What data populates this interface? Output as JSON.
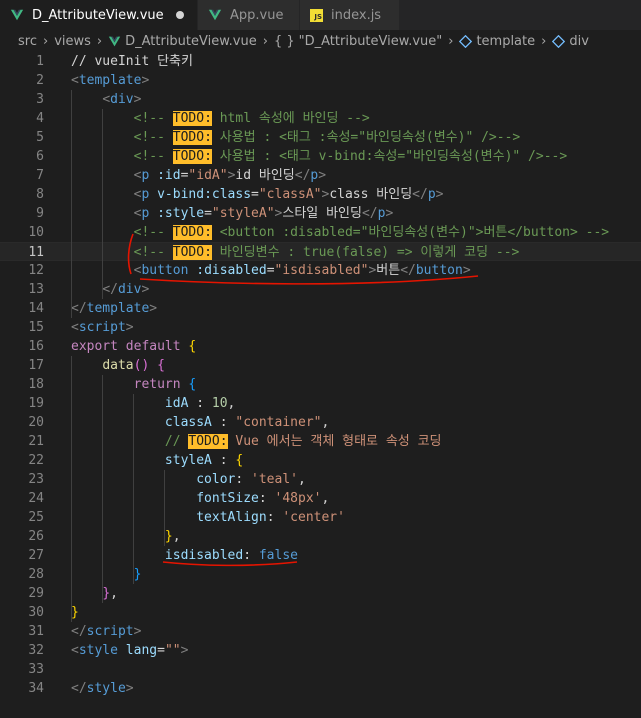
{
  "tabs": [
    {
      "label": "D_AttributeView.vue",
      "icon": "vue-icon",
      "active": true,
      "modified": true
    },
    {
      "label": "App.vue",
      "icon": "vue-icon",
      "active": false
    },
    {
      "label": "index.js",
      "icon": "js-icon",
      "active": false
    }
  ],
  "breadcrumb": {
    "items": [
      "src",
      "views",
      "D_AttributeView.vue",
      "\"D_AttributeView.vue\"",
      "template",
      "div"
    ],
    "symbol_braces": "{ }"
  },
  "js_icon_text": "JS",
  "lines": [
    {
      "n": "1",
      "cur": false,
      "tokens": [
        [
          "plain",
          "// vueInit 단축키"
        ]
      ]
    },
    {
      "n": "2",
      "cur": false,
      "tokens": [
        [
          "punc",
          "<"
        ],
        [
          "tag",
          "template"
        ],
        [
          "punc",
          ">"
        ]
      ]
    },
    {
      "n": "3",
      "cur": false,
      "tokens": [
        [
          "plain",
          "    "
        ],
        [
          "punc",
          "<"
        ],
        [
          "tag",
          "div"
        ],
        [
          "punc",
          ">"
        ]
      ]
    },
    {
      "n": "4",
      "cur": false,
      "tokens": [
        [
          "plain",
          "        "
        ],
        [
          "com",
          "<!-- "
        ],
        [
          "todo",
          "TODO:"
        ],
        [
          "com",
          " html 속성에 바인딩 -->"
        ]
      ]
    },
    {
      "n": "5",
      "cur": false,
      "tokens": [
        [
          "plain",
          "        "
        ],
        [
          "com",
          "<!-- "
        ],
        [
          "todo",
          "TODO:"
        ],
        [
          "com",
          " 사용법 : <태그 :속성=\"바인딩속성(변수)\" />-->"
        ]
      ]
    },
    {
      "n": "6",
      "cur": false,
      "tokens": [
        [
          "plain",
          "        "
        ],
        [
          "com",
          "<!-- "
        ],
        [
          "todo",
          "TODO:"
        ],
        [
          "com",
          " 사용법 : <태그 v-bind:속성=\"바인딩속성(변수)\" />-->"
        ]
      ]
    },
    {
      "n": "7",
      "cur": false,
      "tokens": [
        [
          "plain",
          "        "
        ],
        [
          "punc",
          "<"
        ],
        [
          "tag",
          "p"
        ],
        [
          "plain",
          " "
        ],
        [
          "attr",
          ":id"
        ],
        [
          "plain",
          "="
        ],
        [
          "str",
          "\"idA\""
        ],
        [
          "punc",
          ">"
        ],
        [
          "plain",
          "id 바인딩"
        ],
        [
          "punc",
          "</"
        ],
        [
          "tag",
          "p"
        ],
        [
          "punc",
          ">"
        ]
      ]
    },
    {
      "n": "8",
      "cur": false,
      "tokens": [
        [
          "plain",
          "        "
        ],
        [
          "punc",
          "<"
        ],
        [
          "tag",
          "p"
        ],
        [
          "plain",
          " "
        ],
        [
          "attr",
          "v-bind:class"
        ],
        [
          "plain",
          "="
        ],
        [
          "str",
          "\"classA\""
        ],
        [
          "punc",
          ">"
        ],
        [
          "plain",
          "class 바인딩"
        ],
        [
          "punc",
          "</"
        ],
        [
          "tag",
          "p"
        ],
        [
          "punc",
          ">"
        ]
      ]
    },
    {
      "n": "9",
      "cur": false,
      "tokens": [
        [
          "plain",
          "        "
        ],
        [
          "punc",
          "<"
        ],
        [
          "tag",
          "p"
        ],
        [
          "plain",
          " "
        ],
        [
          "attr",
          ":style"
        ],
        [
          "plain",
          "="
        ],
        [
          "str",
          "\"styleA\""
        ],
        [
          "punc",
          ">"
        ],
        [
          "plain",
          "스타일 바인딩"
        ],
        [
          "punc",
          "</"
        ],
        [
          "tag",
          "p"
        ],
        [
          "punc",
          ">"
        ]
      ]
    },
    {
      "n": "10",
      "cur": false,
      "tokens": [
        [
          "plain",
          "        "
        ],
        [
          "com",
          "<!-- "
        ],
        [
          "todo",
          "TODO:"
        ],
        [
          "com",
          " <button :disabled=\"바인딩속성(변수)\">버튼</button> -->"
        ]
      ]
    },
    {
      "n": "11",
      "cur": true,
      "tokens": [
        [
          "plain",
          "        "
        ],
        [
          "com",
          "<!-- "
        ],
        [
          "todo",
          "TODO:"
        ],
        [
          "com",
          " 바인딩변수 : true(false) => 이렇게 코딩 -->"
        ]
      ]
    },
    {
      "n": "12",
      "cur": false,
      "tokens": [
        [
          "plain",
          "        "
        ],
        [
          "punc",
          "<"
        ],
        [
          "tag",
          "button"
        ],
        [
          "plain",
          " "
        ],
        [
          "attr",
          ":disabled"
        ],
        [
          "plain",
          "="
        ],
        [
          "str",
          "\"isdisabled\""
        ],
        [
          "punc",
          ">"
        ],
        [
          "plain",
          "버튼"
        ],
        [
          "punc",
          "</"
        ],
        [
          "tag",
          "button"
        ],
        [
          "punc",
          ">"
        ]
      ]
    },
    {
      "n": "13",
      "cur": false,
      "tokens": [
        [
          "plain",
          "    "
        ],
        [
          "punc",
          "</"
        ],
        [
          "tag",
          "div"
        ],
        [
          "punc",
          ">"
        ]
      ]
    },
    {
      "n": "14",
      "cur": false,
      "tokens": [
        [
          "punc",
          "</"
        ],
        [
          "tag",
          "template"
        ],
        [
          "punc",
          ">"
        ]
      ]
    },
    {
      "n": "15",
      "cur": false,
      "tokens": [
        [
          "punc",
          "<"
        ],
        [
          "tag",
          "script"
        ],
        [
          "punc",
          ">"
        ]
      ]
    },
    {
      "n": "16",
      "cur": false,
      "tokens": [
        [
          "kw",
          "export"
        ],
        [
          "plain",
          " "
        ],
        [
          "kw",
          "default"
        ],
        [
          "plain",
          " "
        ],
        [
          "br1",
          "{"
        ]
      ]
    },
    {
      "n": "17",
      "cur": false,
      "tokens": [
        [
          "plain",
          "    "
        ],
        [
          "fn",
          "data"
        ],
        [
          "br2",
          "()"
        ],
        [
          "plain",
          " "
        ],
        [
          "br2",
          "{"
        ]
      ]
    },
    {
      "n": "18",
      "cur": false,
      "tokens": [
        [
          "plain",
          "        "
        ],
        [
          "kw",
          "return"
        ],
        [
          "plain",
          " "
        ],
        [
          "br3",
          "{"
        ]
      ]
    },
    {
      "n": "19",
      "cur": false,
      "tokens": [
        [
          "plain",
          "            "
        ],
        [
          "attr",
          "idA"
        ],
        [
          "plain",
          " : "
        ],
        [
          "num",
          "10"
        ],
        [
          "plain",
          ","
        ]
      ]
    },
    {
      "n": "20",
      "cur": false,
      "tokens": [
        [
          "plain",
          "            "
        ],
        [
          "attr",
          "classA"
        ],
        [
          "plain",
          " : "
        ],
        [
          "str",
          "\"container\""
        ],
        [
          "plain",
          ","
        ]
      ]
    },
    {
      "n": "21",
      "cur": false,
      "tokens": [
        [
          "plain",
          "            "
        ],
        [
          "com",
          "// "
        ],
        [
          "todo",
          "TODO:"
        ],
        [
          "str",
          " Vue 에서는 객체 형태로 속성 코딩"
        ]
      ]
    },
    {
      "n": "22",
      "cur": false,
      "tokens": [
        [
          "plain",
          "            "
        ],
        [
          "attr",
          "styleA"
        ],
        [
          "plain",
          " : "
        ],
        [
          "br1",
          "{"
        ]
      ]
    },
    {
      "n": "23",
      "cur": false,
      "tokens": [
        [
          "plain",
          "                "
        ],
        [
          "attr",
          "color"
        ],
        [
          "plain",
          ": "
        ],
        [
          "str",
          "'teal'"
        ],
        [
          "plain",
          ","
        ]
      ]
    },
    {
      "n": "24",
      "cur": false,
      "tokens": [
        [
          "plain",
          "                "
        ],
        [
          "attr",
          "fontSize"
        ],
        [
          "plain",
          ": "
        ],
        [
          "str",
          "'48px'"
        ],
        [
          "plain",
          ","
        ]
      ]
    },
    {
      "n": "25",
      "cur": false,
      "tokens": [
        [
          "plain",
          "                "
        ],
        [
          "attr",
          "textAlign"
        ],
        [
          "plain",
          ": "
        ],
        [
          "str",
          "'center'"
        ]
      ]
    },
    {
      "n": "26",
      "cur": false,
      "tokens": [
        [
          "plain",
          "            "
        ],
        [
          "br1",
          "}"
        ],
        [
          "plain",
          ","
        ]
      ]
    },
    {
      "n": "27",
      "cur": false,
      "tokens": [
        [
          "plain",
          "            "
        ],
        [
          "attr",
          "isdisabled"
        ],
        [
          "plain",
          ": "
        ],
        [
          "kw2",
          "false"
        ]
      ]
    },
    {
      "n": "28",
      "cur": false,
      "tokens": [
        [
          "plain",
          "        "
        ],
        [
          "br3",
          "}"
        ]
      ]
    },
    {
      "n": "29",
      "cur": false,
      "tokens": [
        [
          "plain",
          "    "
        ],
        [
          "br2",
          "}"
        ],
        [
          "plain",
          ","
        ]
      ]
    },
    {
      "n": "30",
      "cur": false,
      "tokens": [
        [
          "br1",
          "}"
        ]
      ]
    },
    {
      "n": "31",
      "cur": false,
      "tokens": [
        [
          "punc",
          "</"
        ],
        [
          "tag",
          "script"
        ],
        [
          "punc",
          ">"
        ]
      ]
    },
    {
      "n": "32",
      "cur": false,
      "tokens": [
        [
          "punc",
          "<"
        ],
        [
          "tag",
          "style"
        ],
        [
          "plain",
          " "
        ],
        [
          "attr",
          "lang"
        ],
        [
          "plain",
          "="
        ],
        [
          "str",
          "\"\""
        ],
        [
          "punc",
          ">"
        ]
      ]
    },
    {
      "n": "33",
      "cur": false,
      "tokens": []
    },
    {
      "n": "34",
      "cur": false,
      "tokens": [
        [
          "punc",
          "</"
        ],
        [
          "tag",
          "style"
        ],
        [
          "punc",
          ">"
        ]
      ]
    }
  ],
  "colors": {
    "background": "#1e1e1e",
    "annotation_red": "#e51400",
    "todo_highlight": "#ffbd2a"
  }
}
